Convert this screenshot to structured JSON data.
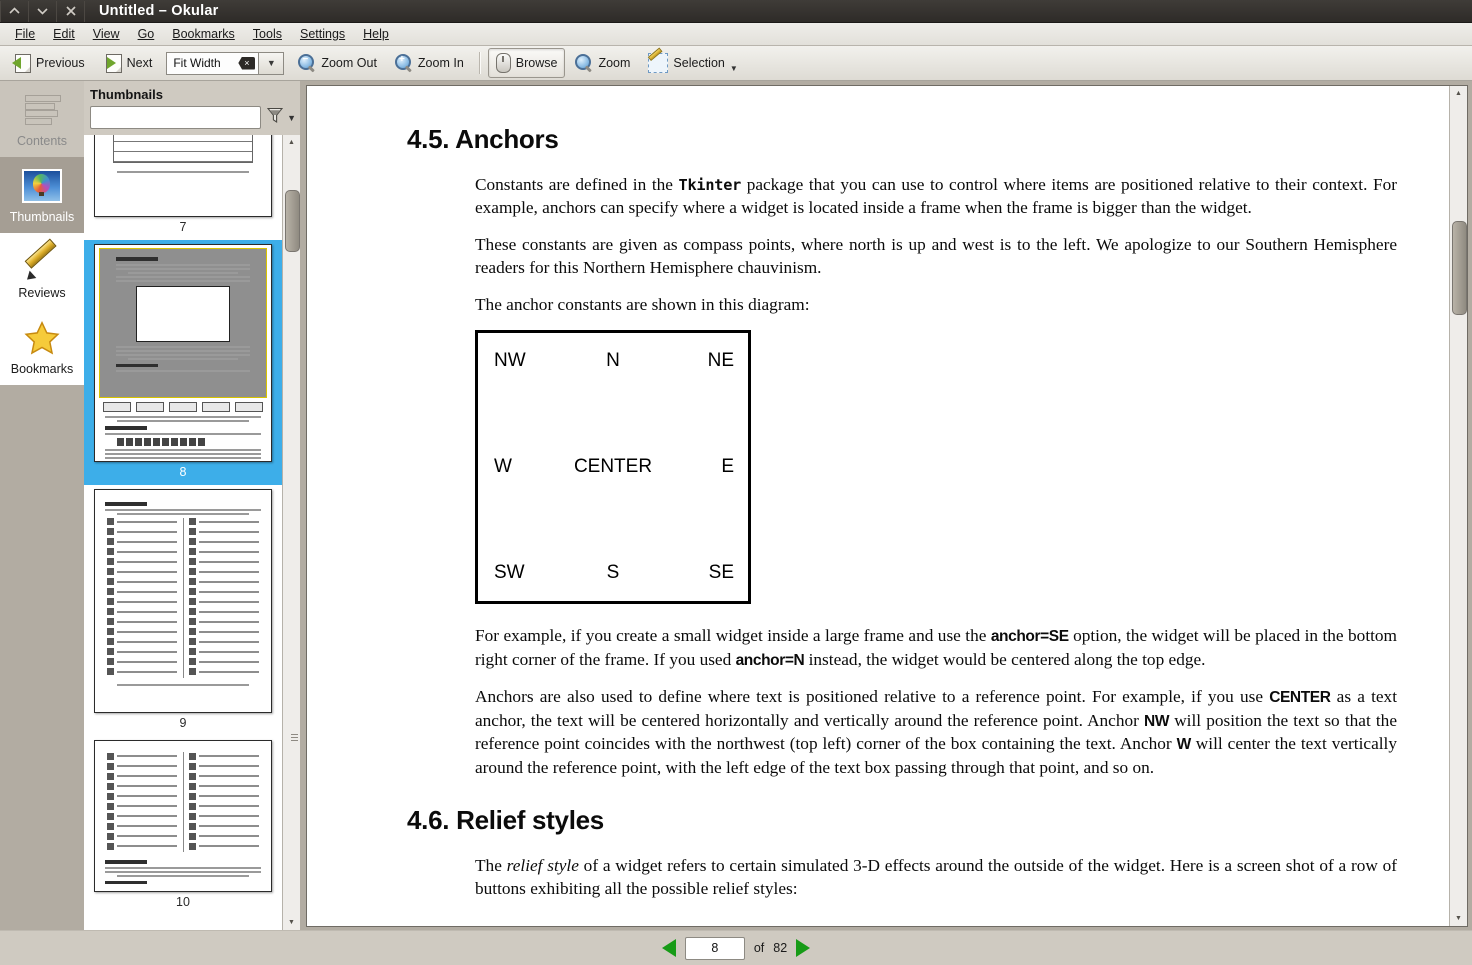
{
  "window": {
    "title": "Untitled – Okular",
    "controls": [
      {
        "name": "shade-button",
        "glyph": "^"
      },
      {
        "name": "minimize-button",
        "glyph": "v"
      },
      {
        "name": "close-button",
        "glyph": "×"
      }
    ]
  },
  "menubar": {
    "items": [
      "File",
      "Edit",
      "View",
      "Go",
      "Bookmarks",
      "Tools",
      "Settings",
      "Help"
    ]
  },
  "toolbar": {
    "previous_label": "Previous",
    "next_label": "Next",
    "zoom_combo_value": "Fit Width",
    "zoom_out_label": "Zoom Out",
    "zoom_in_label": "Zoom In",
    "browse_label": "Browse",
    "zoom_label": "Zoom",
    "selection_label": "Selection"
  },
  "rail": {
    "items": [
      {
        "label": "Contents",
        "icon": "contents-icon",
        "state": "disabled"
      },
      {
        "label": "Thumbnails",
        "icon": "thumbnails-icon",
        "state": "selected"
      },
      {
        "label": "Reviews",
        "icon": "reviews-pencil-icon",
        "state": "plain"
      },
      {
        "label": "Bookmarks",
        "icon": "bookmarks-star-icon",
        "state": "plain"
      }
    ]
  },
  "thumbnails": {
    "title": "Thumbnails",
    "search_value": "",
    "search_placeholder": "",
    "filter_icon": "funnel-icon",
    "pages": [
      {
        "number": "7",
        "selected": false
      },
      {
        "number": "8",
        "selected": true
      },
      {
        "number": "9",
        "selected": false
      },
      {
        "number": "10",
        "selected": false
      }
    ]
  },
  "document": {
    "section1": {
      "heading": "4.5. Anchors",
      "p1_a": "Constants are defined in the ",
      "p1_code": "Tkinter",
      "p1_b": " package that you can use to control where items are positioned relative to their context. For example, anchors can specify where a widget is located inside a frame when the frame is bigger than the widget.",
      "p2": "These constants are given as compass points, where north is up and west is to the left. We apologize to our Southern Hemisphere readers for this Northern Hemisphere chauvinism.",
      "p3": "The anchor constants are shown in this diagram:",
      "p4_a": "For example, if you create a small widget inside a large frame and use the ",
      "p4_b1": "anchor=SE",
      "p4_c": " option, the widget will be placed in the bottom right corner of the frame. If you used ",
      "p4_b2": "anchor=N",
      "p4_d": " instead, the widget would be centered along the top edge.",
      "p5_a": "Anchors are also used to define where text is positioned relative to a reference point. For example, if you use ",
      "p5_b1": "CENTER",
      "p5_c": " as a text anchor, the text will be centered horizontally and vertically around the reference point. Anchor ",
      "p5_b2": "NW",
      "p5_d": " will position the text so that the reference point coincides with the northwest (top left) corner of the box containing the text. Anchor ",
      "p5_b3": "W",
      "p5_e": " will center the text vertically around the reference point, with the left edge of the text box passing through that point, and so on."
    },
    "anchor_diagram": {
      "nw": "NW",
      "n": "N",
      "ne": "NE",
      "w": "W",
      "center": "CENTER",
      "e": "E",
      "sw": "SW",
      "s": "S",
      "se": "SE"
    },
    "section2": {
      "heading": "4.6. Relief styles",
      "p1_a": "The ",
      "p1_i": "relief style",
      "p1_b": " of a widget refers to certain simulated 3-D effects around the outside of the widget. Here is a screen shot of a row of buttons exhibiting all the possible relief styles:"
    }
  },
  "navigation": {
    "current_page": "8",
    "of_label": "of",
    "total_pages": "82",
    "prev_icon": "previous-page-triangle-icon",
    "next_icon": "next-page-triangle-icon"
  },
  "colors": {
    "selection_blue": "#3daee9",
    "titlebar": "#2e2b28",
    "chrome": "#b2aca2",
    "panel": "#cfcac1",
    "green_arrow": "#179b17"
  }
}
